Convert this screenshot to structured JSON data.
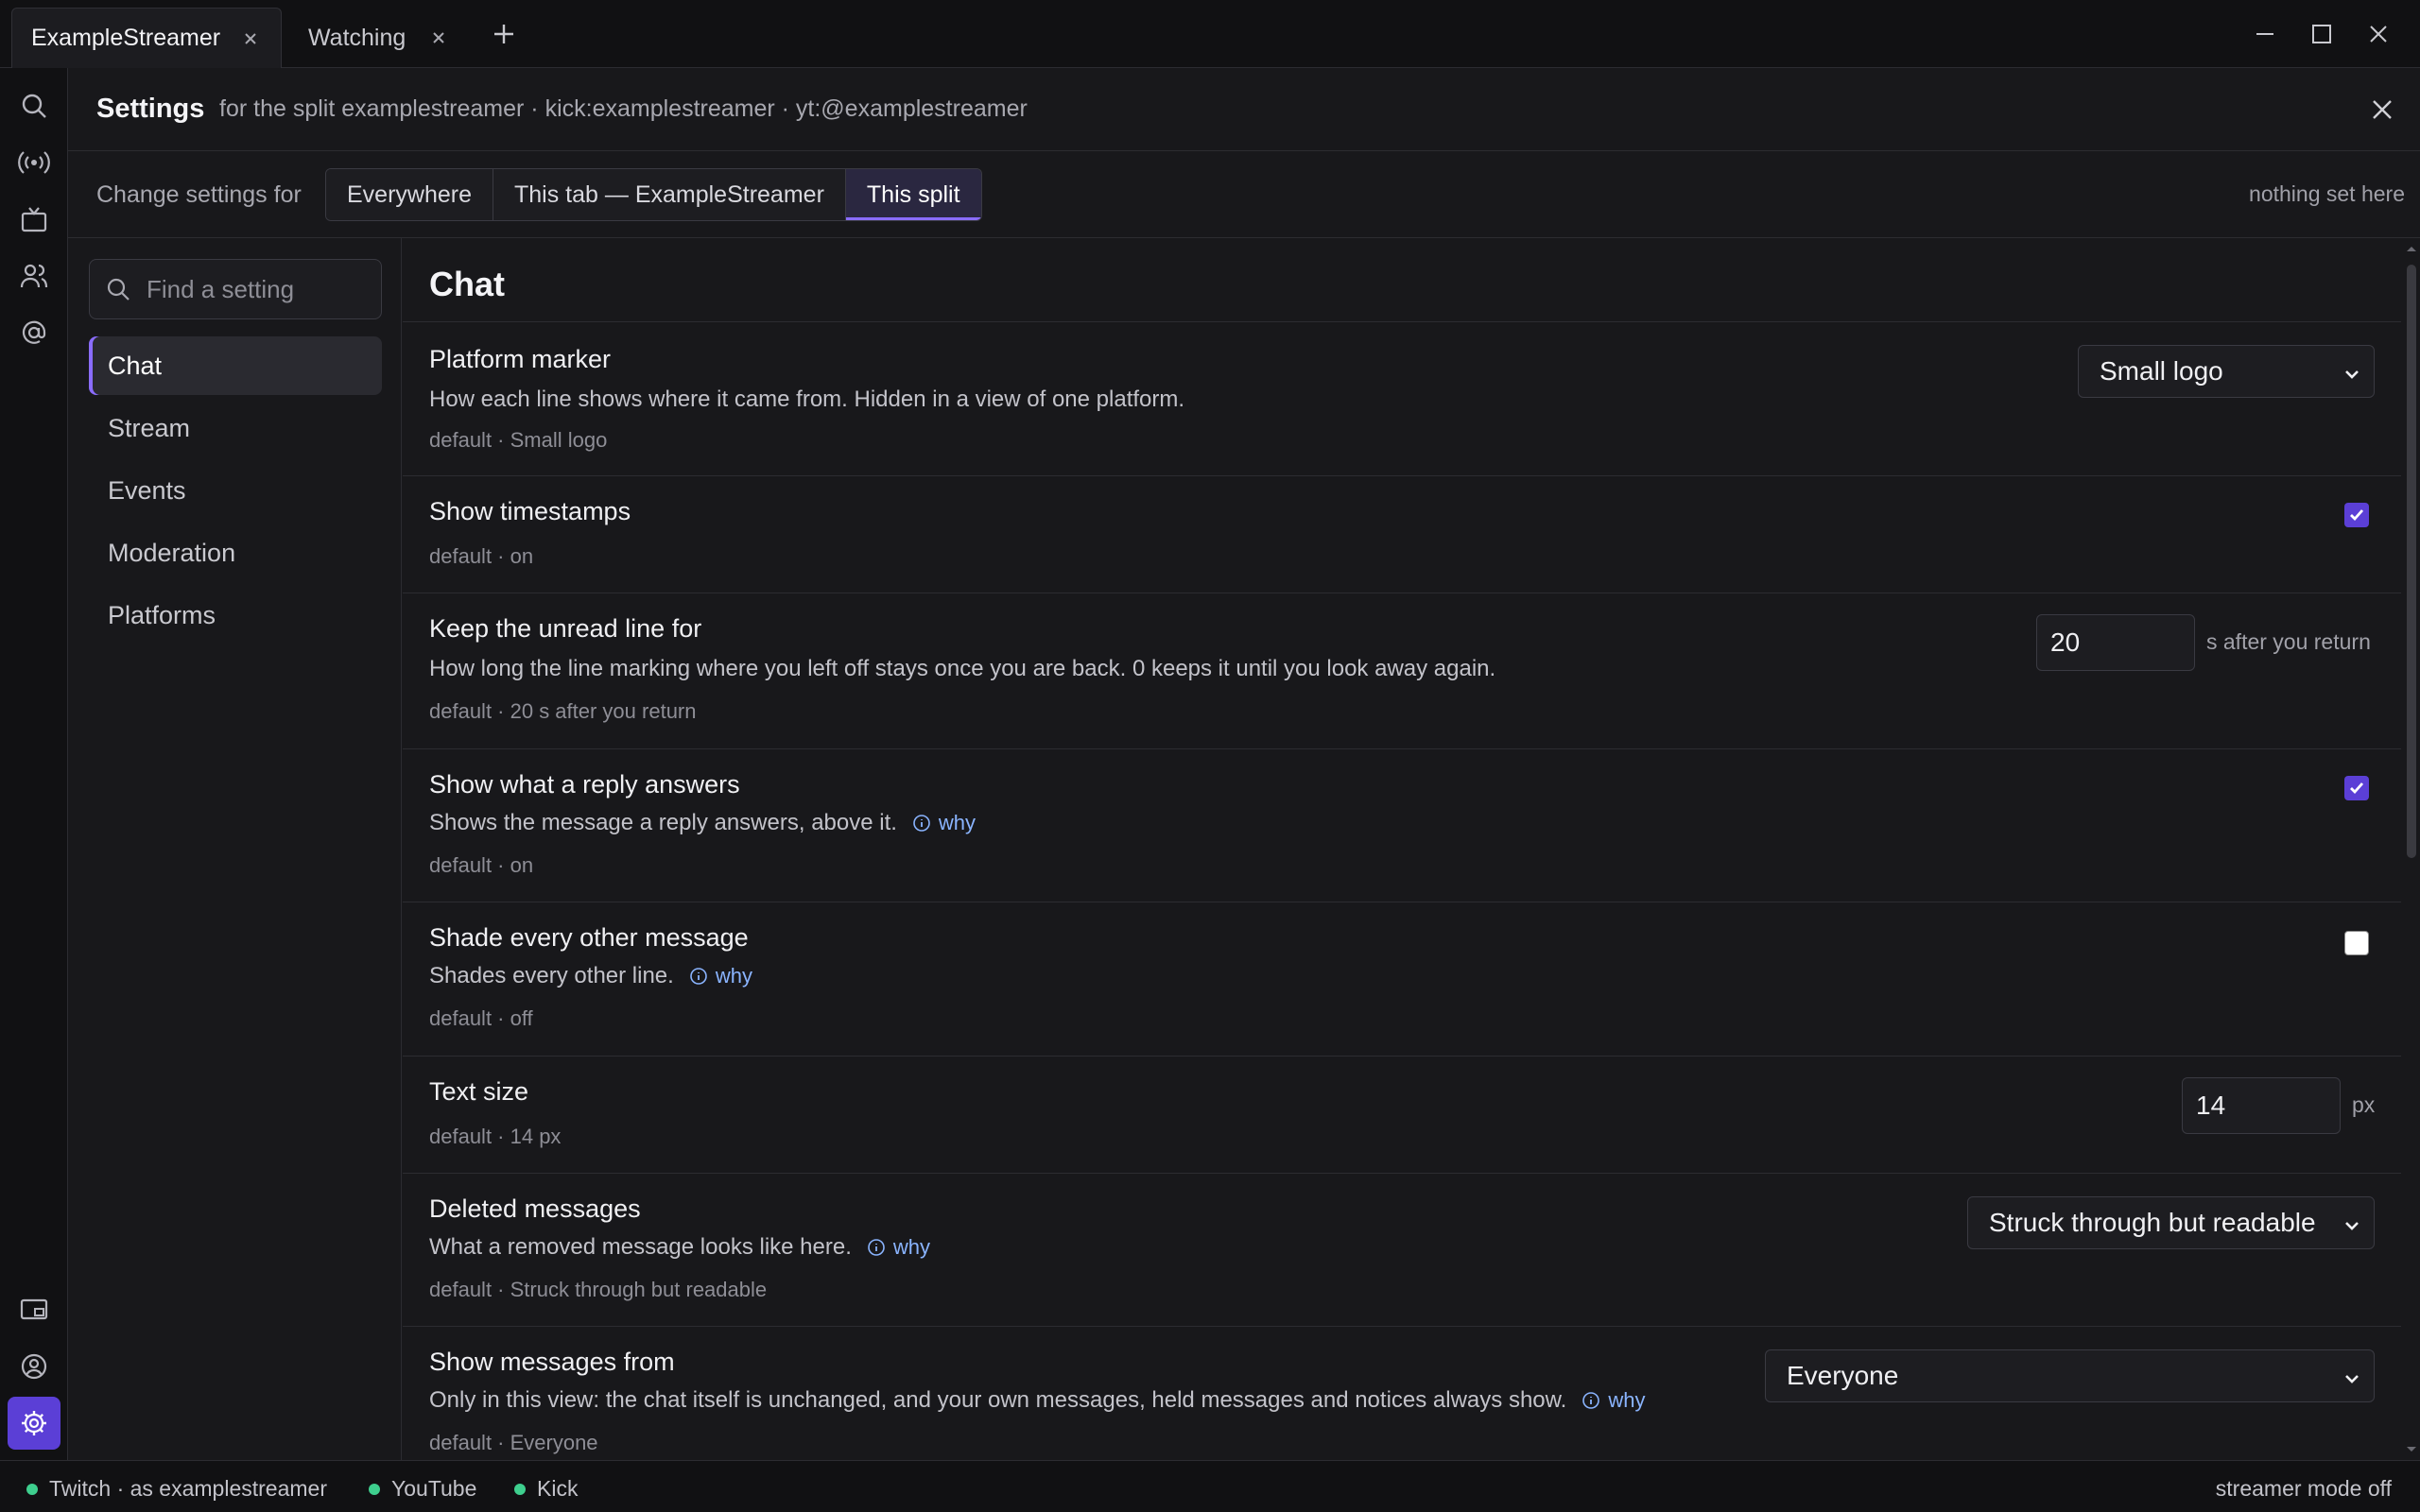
{
  "tabs": [
    {
      "label": "ExampleStreamer",
      "active": true
    },
    {
      "label": "Watching",
      "active": false
    }
  ],
  "header": {
    "title": "Settings",
    "subtitle": "for the split examplestreamer · kick:examplestreamer · yt:@examplestreamer"
  },
  "scope": {
    "lead": "Change settings for",
    "options": [
      "Everywhere",
      "This tab — ExampleStreamer",
      "This split"
    ],
    "selected": "This split",
    "status": "nothing set here"
  },
  "sidebar": {
    "search_placeholder": "Find a setting",
    "items": [
      "Chat",
      "Stream",
      "Events",
      "Moderation",
      "Platforms"
    ],
    "selected": "Chat"
  },
  "section_title": "Chat",
  "why_label": "why",
  "settings": {
    "platform_marker": {
      "name": "Platform marker",
      "desc": "How each line shows where it came from. Hidden in a view of one platform.",
      "default": "default · Small logo",
      "value": "Small logo"
    },
    "timestamps": {
      "name": "Show timestamps",
      "default": "default · on",
      "checked": true
    },
    "unread_line": {
      "name": "Keep the unread line for",
      "desc": "How long the line marking where you left off stays once you are back. 0 keeps it until you look away again.",
      "default": "default · 20 s after you return",
      "value": "20",
      "unit": "s after you return"
    },
    "reply_answers": {
      "name": "Show what a reply answers",
      "desc": "Shows the message a reply answers, above it.",
      "default": "default · on",
      "checked": true
    },
    "shade_alternate": {
      "name": "Shade every other message",
      "desc": "Shades every other line.",
      "default": "default · off",
      "checked": false
    },
    "text_size": {
      "name": "Text size",
      "default": "default · 14 px",
      "value": "14",
      "unit": "px"
    },
    "deleted_messages": {
      "name": "Deleted messages",
      "desc": "What a removed message looks like here.",
      "default": "default · Struck through but readable",
      "value": "Struck through but readable"
    },
    "messages_from": {
      "name": "Show messages from",
      "desc": "Only in this view: the chat itself is unchanged, and your own messages, held messages and notices always show.",
      "default": "default · Everyone",
      "value": "Everyone"
    }
  },
  "status": {
    "twitch": "Twitch · as examplestreamer",
    "youtube": "YouTube",
    "kick": "Kick",
    "streamer_mode": "streamer mode off"
  },
  "colors": {
    "accent": "#5b3fd6",
    "accent_light": "#8a6cff",
    "link": "#8ab4ff",
    "online": "#3ecf8e"
  }
}
